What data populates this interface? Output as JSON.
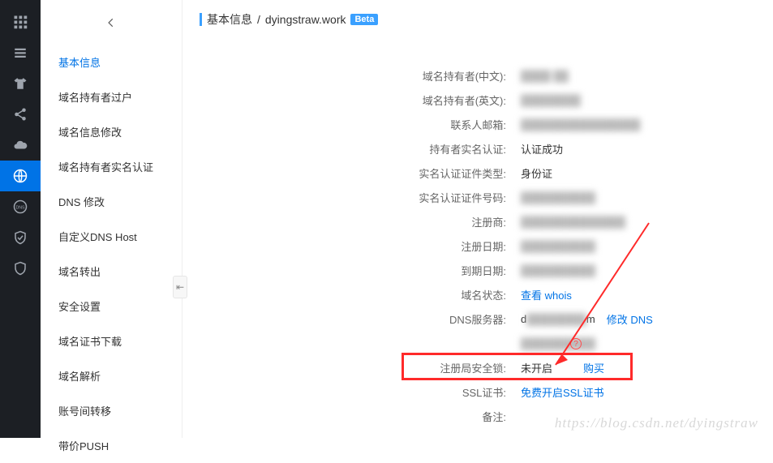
{
  "iconbar": {
    "items": [
      {
        "name": "apps-icon"
      },
      {
        "name": "list-icon"
      },
      {
        "name": "tshirt-icon"
      },
      {
        "name": "share-icon"
      },
      {
        "name": "cloud-icon"
      },
      {
        "name": "globe-icon",
        "active": true
      },
      {
        "name": "dns-icon"
      },
      {
        "name": "shield-check-icon"
      },
      {
        "name": "shield-outline-icon"
      }
    ]
  },
  "sidebar": {
    "items": [
      {
        "label": "基本信息",
        "active": true
      },
      {
        "label": "域名持有者过户"
      },
      {
        "label": "域名信息修改"
      },
      {
        "label": "域名持有者实名认证"
      },
      {
        "label": "DNS 修改"
      },
      {
        "label": "自定义DNS Host"
      },
      {
        "label": "域名转出"
      },
      {
        "label": "安全设置"
      },
      {
        "label": "域名证书下载"
      },
      {
        "label": "域名解析"
      },
      {
        "label": "账号间转移"
      },
      {
        "label": "带价PUSH"
      }
    ]
  },
  "breadcrumb": {
    "a": "基本信息",
    "sep": "/",
    "b": "dyingstraw.work",
    "beta": "Beta"
  },
  "info": {
    "owner_cn_label": "域名持有者(中文):",
    "owner_en_label": "域名持有者(英文):",
    "email_label": "联系人邮箱:",
    "realname_label": "持有者实名认证:",
    "realname_value": "认证成功",
    "idtype_label": "实名认证证件类型:",
    "idtype_value": "身份证",
    "idnum_label": "实名认证证件号码:",
    "registrar_label": "注册商:",
    "regdate_label": "注册日期:",
    "expdate_label": "到期日期:",
    "status_label": "域名状态:",
    "status_link": "查看 whois",
    "dns_label": "DNS服务器:",
    "dns_value_a": "d",
    "dns_value_b": "m",
    "dns_link": "修改 DNS",
    "reglock_label": "注册局安全锁:",
    "reglock_value": "未开启",
    "reglock_link": "购买",
    "ssl_label": "SSL证书:",
    "ssl_link": "免费开启SSL证书",
    "remark_label": "备注:"
  },
  "watermark": "https://blog.csdn.net/dyingstraw"
}
